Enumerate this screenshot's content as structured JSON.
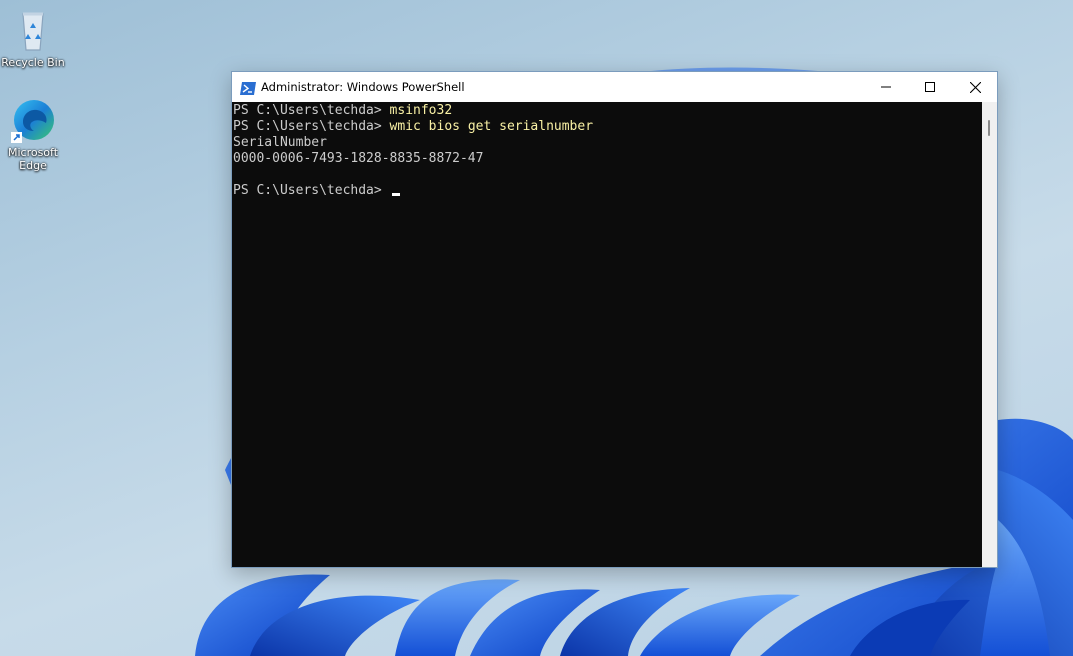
{
  "desktop": {
    "icons": [
      {
        "label": "Recycle Bin",
        "icon": "recycle-bin-icon"
      },
      {
        "label": "Microsoft Edge",
        "label_line1": "Microsoft",
        "label_line2": "Edge",
        "icon": "edge-icon"
      }
    ]
  },
  "window": {
    "title": "Administrator: Windows PowerShell",
    "icon": "powershell-icon",
    "controls": {
      "minimize": "minimize-icon",
      "maximize": "maximize-icon",
      "close": "close-icon"
    }
  },
  "console": {
    "lines": [
      {
        "prompt": "PS C:\\Users\\techda> ",
        "command": "msinfo32"
      },
      {
        "prompt": "PS C:\\Users\\techda> ",
        "command": "wmic bios get serialnumber"
      },
      {
        "output": "SerialNumber"
      },
      {
        "output": "0000-0006-7493-1828-8835-8872-47"
      },
      {
        "output": ""
      },
      {
        "prompt": "PS C:\\Users\\techda> ",
        "command": ""
      }
    ]
  },
  "colors": {
    "console_bg": "#0c0c0c",
    "console_text": "#cccccc",
    "command_text": "#f9f1a5",
    "wallpaper_blue": "#1a5ce6"
  }
}
